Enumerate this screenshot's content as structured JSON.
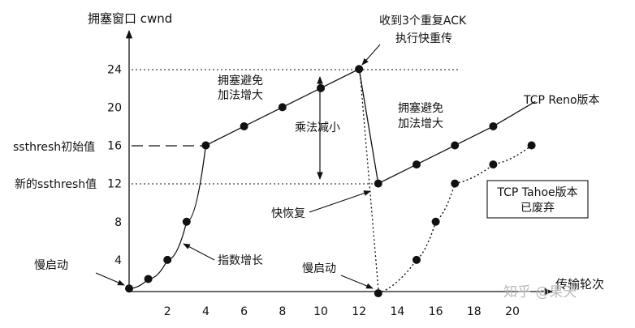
{
  "chart_data": {
    "type": "line",
    "ylabel": "拥塞窗口 cwnd",
    "xlabel": "传输轮次",
    "xlim": [
      0,
      22
    ],
    "ylim": [
      0,
      28
    ],
    "x_ticks": [
      2,
      4,
      6,
      8,
      10,
      12,
      14,
      16,
      18,
      20
    ],
    "y_ticks": [
      4,
      8,
      12,
      16,
      20,
      24
    ],
    "series": [
      {
        "name": "TCP Reno版本",
        "points": [
          [
            0,
            1
          ],
          [
            1,
            2
          ],
          [
            2,
            4
          ],
          [
            3,
            8
          ],
          [
            4,
            16
          ],
          [
            6,
            18
          ],
          [
            8,
            20
          ],
          [
            10,
            22
          ],
          [
            12,
            24
          ],
          [
            13,
            12
          ],
          [
            15,
            14
          ],
          [
            17,
            16
          ],
          [
            19,
            18
          ]
        ],
        "ext_end": [
          21.2,
          20.6
        ]
      },
      {
        "name": "TCP Tahoe版本 已废弃",
        "points": [
          [
            12,
            24
          ],
          [
            13,
            0.5
          ],
          [
            15,
            4
          ],
          [
            16,
            8
          ],
          [
            17,
            12
          ],
          [
            19,
            14
          ],
          [
            21,
            16
          ]
        ]
      }
    ]
  },
  "labels": {
    "ssthresh_initial": "ssthresh初始值",
    "ssthresh_new": "新的ssthresh值",
    "ack": "收到3个重复ACK",
    "fast_retransmit": "执行快重传",
    "ca1_line1": "拥塞避免",
    "ca1_line2": "加法增大",
    "ca2_line1": "拥塞避免",
    "ca2_line2": "加法增大",
    "mult_decrease": "乘法减小",
    "reno": "TCP Reno版本",
    "tahoe_line1": "TCP Tahoe版本",
    "tahoe_line2": "已废弃",
    "fast_recovery": "快恢复",
    "exp_growth": "指数增长",
    "slow_start_1": "慢启动",
    "slow_start_2": "慢启动",
    "watermark": "知乎 @果天"
  }
}
